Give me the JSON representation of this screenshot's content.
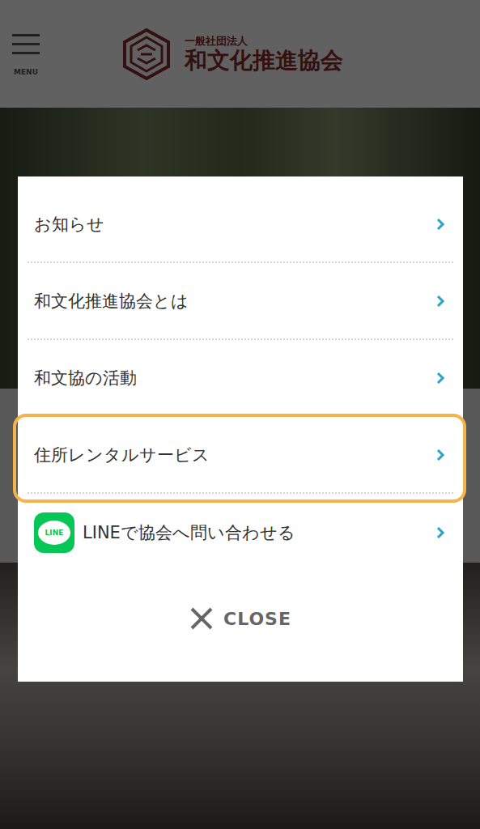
{
  "header": {
    "menu_label": "MENU",
    "org_type": "一般社団法人",
    "org_name": "和文化推進協会"
  },
  "menu": {
    "items": [
      {
        "label": "お知らせ",
        "kind": "text",
        "highlighted": false
      },
      {
        "label": "和文化推進協会とは",
        "kind": "text",
        "highlighted": false
      },
      {
        "label": "和文協の活動",
        "kind": "text",
        "highlighted": false
      },
      {
        "label": "住所レンタルサービス",
        "kind": "text",
        "highlighted": true
      },
      {
        "label": "LINEで協会へ問い合わせる",
        "kind": "line",
        "icon_text": "LINE",
        "highlighted": false
      }
    ],
    "close": "CLOSE"
  }
}
